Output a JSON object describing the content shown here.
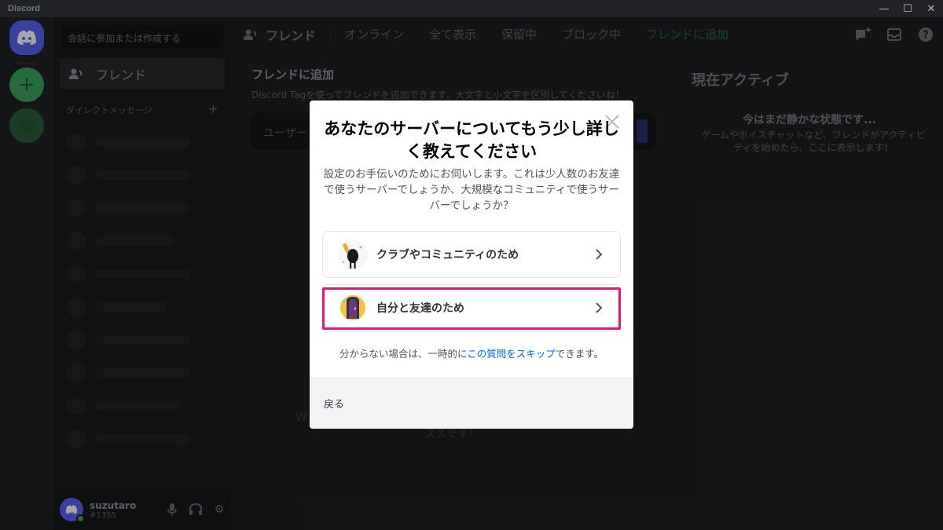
{
  "window": {
    "title": "Discord"
  },
  "sidebar": {
    "search_placeholder": "会話に参加または作成する",
    "friends_label": "フレンド",
    "dm_header": "ダイレクトメッセージ",
    "dm_add": "+"
  },
  "user": {
    "name": "suzutaro",
    "tag": "#1355"
  },
  "topbar": {
    "title": "フレンド",
    "tabs": [
      "オンライン",
      "全て表示",
      "保留中",
      "ブロック中"
    ],
    "add_friend_tab": "フレンドに追加"
  },
  "add_friend": {
    "title": "フレンドに追加",
    "description": "Discord Tagを使ってフレンドを追加できます。大文字と小文字を区別してくださいね！",
    "input_placeholder": "ユーザー"
  },
  "empty_state": {
    "line1": "W",
    "line2": "スズです！"
  },
  "active_now": {
    "title": "現在アクティブ",
    "quiet": "今はまだ静かな状態です...",
    "description": "ゲームやボイスチャットなど、フレンドがアクティビティを始めたら、ここに表示します！"
  },
  "modal": {
    "title": "あなたのサーバーについてもう少し詳しく教えてください",
    "description": "設定のお手伝いのためにお伺いします。これは少人数のお友達で使うサーバーでしょうか、大規模なコミュニティで使うサーバーでしょうか？",
    "options": [
      {
        "label": "クラブやコミュニティのため",
        "icon": "club-community-icon"
      },
      {
        "label": "自分と友達のため",
        "icon": "me-and-friends-icon"
      }
    ],
    "skip_prefix": "分からない場合は、一時的に",
    "skip_link": "この質問をスキップ",
    "skip_suffix": "できます。",
    "back": "戻る"
  },
  "colors": {
    "accent": "#5865f2",
    "highlight": "#e5177a",
    "link": "#0068e0",
    "online": "#3ba55d"
  }
}
